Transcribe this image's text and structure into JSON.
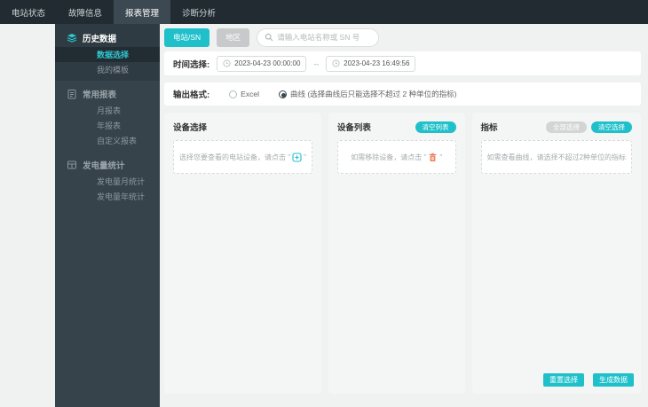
{
  "navbar": {
    "items": [
      {
        "label": "电站状态",
        "active": false
      },
      {
        "label": "故障信息",
        "active": false
      },
      {
        "label": "报表管理",
        "active": true
      },
      {
        "label": "诊断分析",
        "active": false
      }
    ]
  },
  "sidebar": {
    "groups": [
      {
        "label": "历史数据",
        "icon": "layers-icon",
        "children": [
          {
            "label": "数据选择",
            "selected": true
          },
          {
            "label": "我的模板",
            "selected": false
          }
        ]
      },
      {
        "label": "常用报表",
        "icon": "report-icon",
        "children": [
          {
            "label": "月报表",
            "selected": false
          },
          {
            "label": "年报表",
            "selected": false
          },
          {
            "label": "自定义报表",
            "selected": false
          }
        ]
      },
      {
        "label": "发电量统计",
        "icon": "stats-grid-icon",
        "children": [
          {
            "label": "发电量月统计",
            "selected": false
          },
          {
            "label": "发电量年统计",
            "selected": false
          }
        ]
      }
    ]
  },
  "filter": {
    "station_sn_button": "电站/SN",
    "region_button": "地区",
    "search_placeholder": "请输入电站名称或 SN 号",
    "search_icon": "search-icon"
  },
  "time_row": {
    "label": "时间选择:",
    "start_value": "2023-04-23 00:00:00",
    "separator": "--",
    "end_value": "2023-04-23 16:49:56",
    "icon": "clock-icon"
  },
  "format_row": {
    "label": "输出格式:",
    "options": [
      {
        "label": "Excel",
        "selected": false
      },
      {
        "label": "曲线 (选择曲线后只能选择不超过 2 种单位的指标)",
        "selected": true
      }
    ]
  },
  "panels": {
    "device_select": {
      "title": "设备选择",
      "hint_prefix": "选择您要查看的电站设备，请点击 \"",
      "hint_icon": "add-device-icon",
      "hint_suffix": "\""
    },
    "device_list": {
      "title": "设备列表",
      "clear_button": "清空列表",
      "hint_prefix": "如需移除设备，请点击 \"",
      "hint_icon": "trash-icon",
      "hint_suffix": "\""
    },
    "indicators": {
      "title": "指标",
      "select_all_button": "全部选择",
      "clear_button": "清空选择",
      "hint": "如需查看曲线，请选择不超过2种单位的指标"
    }
  },
  "actions": {
    "reset_button": "重置选择",
    "generate_button": "生成数据"
  },
  "colors": {
    "accent_teal": "#1fc0ca",
    "navbar_bg": "#212b31",
    "navbar_active_bg": "#3d4952",
    "sidebar_bg": "#37434b",
    "sidebar_selected_bg": "#222c33",
    "sidebar_selected_text": "#2fc7cf",
    "page_bg": "#f0f1f1",
    "panel_bg": "#f4f5f5",
    "trash_icon_orange": "#ee7950",
    "gray_button": "#c7c9ca",
    "disabled_pill_gray": "#d3d5d5"
  }
}
